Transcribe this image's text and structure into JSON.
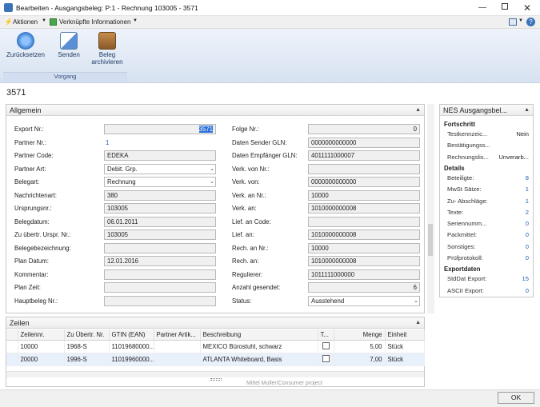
{
  "window": {
    "title": "Bearbeiten - Ausgangsbeleg: P:1 - Rechnung 103005 - 3571"
  },
  "menubar": {
    "actions": "Aktionen",
    "related": "Verknüpfte Informationen"
  },
  "ribbon": {
    "reset": "Zurücksetzen",
    "send": "Senden",
    "archive_line1": "Beleg",
    "archive_line2": "archivieren",
    "group": "Vorgang"
  },
  "page": {
    "id": "3571"
  },
  "general": {
    "title": "Allgemein",
    "left": [
      {
        "label": "Export Nr.:",
        "value": "3571"
      },
      {
        "label": "Partner Nr.:",
        "value": "1"
      },
      {
        "label": "Partner Code:",
        "value": "EDEKA"
      },
      {
        "label": "Partner Art:",
        "value": "Debit. Grp."
      },
      {
        "label": "Belegart:",
        "value": "Rechnung"
      },
      {
        "label": "Nachrichtenart:",
        "value": "380"
      },
      {
        "label": "Ursprungsnr.:",
        "value": "103005"
      },
      {
        "label": "Belegdatum:",
        "value": "06.01.2011"
      },
      {
        "label": "Zu übertr. Urspr. Nr.:",
        "value": "103005"
      },
      {
        "label": "Belegebezeichnung:",
        "value": ""
      },
      {
        "label": "Plan Datum:",
        "value": "12.01.2016"
      },
      {
        "label": "Kommentar:",
        "value": ""
      },
      {
        "label": "Plan Zeit:",
        "value": ""
      },
      {
        "label": "Hauptbeleg Nr.:",
        "value": ""
      }
    ],
    "right": [
      {
        "label": "Folge Nr.:",
        "value": "0"
      },
      {
        "label": "Daten Sender GLN:",
        "value": "0000000000000"
      },
      {
        "label": "Daten Empfänger GLN:",
        "value": "4011111000007"
      },
      {
        "label": "Verk. von Nr.:",
        "value": ""
      },
      {
        "label": "Verk. von:",
        "value": "0000000000000"
      },
      {
        "label": "Verk. an Nr.:",
        "value": "10000"
      },
      {
        "label": "Verk. an:",
        "value": "1010000000008"
      },
      {
        "label": "Lief. an Code:",
        "value": ""
      },
      {
        "label": "Lief. an:",
        "value": "1010000000008"
      },
      {
        "label": "Rech. an Nr.:",
        "value": "10000"
      },
      {
        "label": "Rech. an:",
        "value": "1010000000008"
      },
      {
        "label": "Regulierer:",
        "value": "1011111000000"
      },
      {
        "label": "Anzahl gesendet:",
        "value": "6"
      },
      {
        "label": "Status:",
        "value": "Ausstehend"
      }
    ]
  },
  "factbox": {
    "title": "NES Ausgangsbel...",
    "sections": [
      {
        "title": "Fortschritt",
        "rows": [
          {
            "label": "Testkennzeic...",
            "value": "Nein"
          },
          {
            "label": "Bestätigungss...",
            "value": ""
          },
          {
            "label": "Rechnungslis...",
            "value": "Unverarb..."
          }
        ]
      },
      {
        "title": "Details",
        "rows": [
          {
            "label": "Beteiligte:",
            "value": "8"
          },
          {
            "label": "MwSt Sätze:",
            "value": "1"
          },
          {
            "label": "Zu- Abschläge:",
            "value": "1"
          },
          {
            "label": "Texte:",
            "value": "2"
          },
          {
            "label": "Seriennumm...",
            "value": "0"
          },
          {
            "label": "Packmittel:",
            "value": "0"
          },
          {
            "label": "Sonstiges:",
            "value": "0"
          },
          {
            "label": "Prüfprotokoll:",
            "value": "0"
          }
        ]
      },
      {
        "title": "Exportdaten",
        "rows": [
          {
            "label": "StdDat Export:",
            "value": "15"
          },
          {
            "label": "ASCII Export:",
            "value": "0"
          }
        ]
      }
    ]
  },
  "lines": {
    "title": "Zeilen",
    "columns": [
      "Zeilennr.",
      "Zu Übertr. Nr.",
      "GTIN (EAN)",
      "Partner Artik...",
      "Beschreibung",
      "T...",
      "Menge",
      "Einheit"
    ],
    "rows": [
      {
        "line": "10000",
        "ref": "1968-S",
        "gtin": "11019680000...",
        "partner": "",
        "desc": "MEXICO Bürostuhl, schwarz",
        "qty": "5,00",
        "unit": "Stück"
      },
      {
        "line": "20000",
        "ref": "1996-S",
        "gtin": "11019960000...",
        "partner": "",
        "desc": "ATLANTA Whiteboard, Basis",
        "qty": "7,00",
        "unit": "Stück"
      }
    ],
    "footer": "Mittel Muller/Consumer project"
  },
  "buttons": {
    "ok": "OK"
  }
}
